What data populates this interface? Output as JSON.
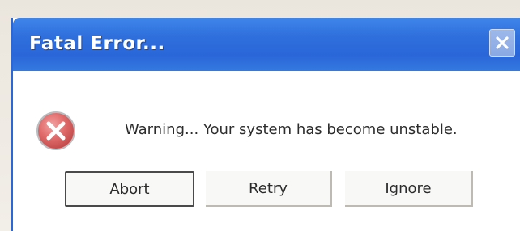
{
  "window": {
    "title": "Fatal Error...",
    "close_icon": "close-icon"
  },
  "content": {
    "icon": "error-icon",
    "message": "Warning... Your system has become unstable."
  },
  "buttons": {
    "abort": "Abort",
    "retry": "Retry",
    "ignore": "Ignore"
  },
  "colors": {
    "titlebar": "#2f6fdd",
    "title_text": "#ffffff",
    "error_icon": "#e06a6a"
  }
}
